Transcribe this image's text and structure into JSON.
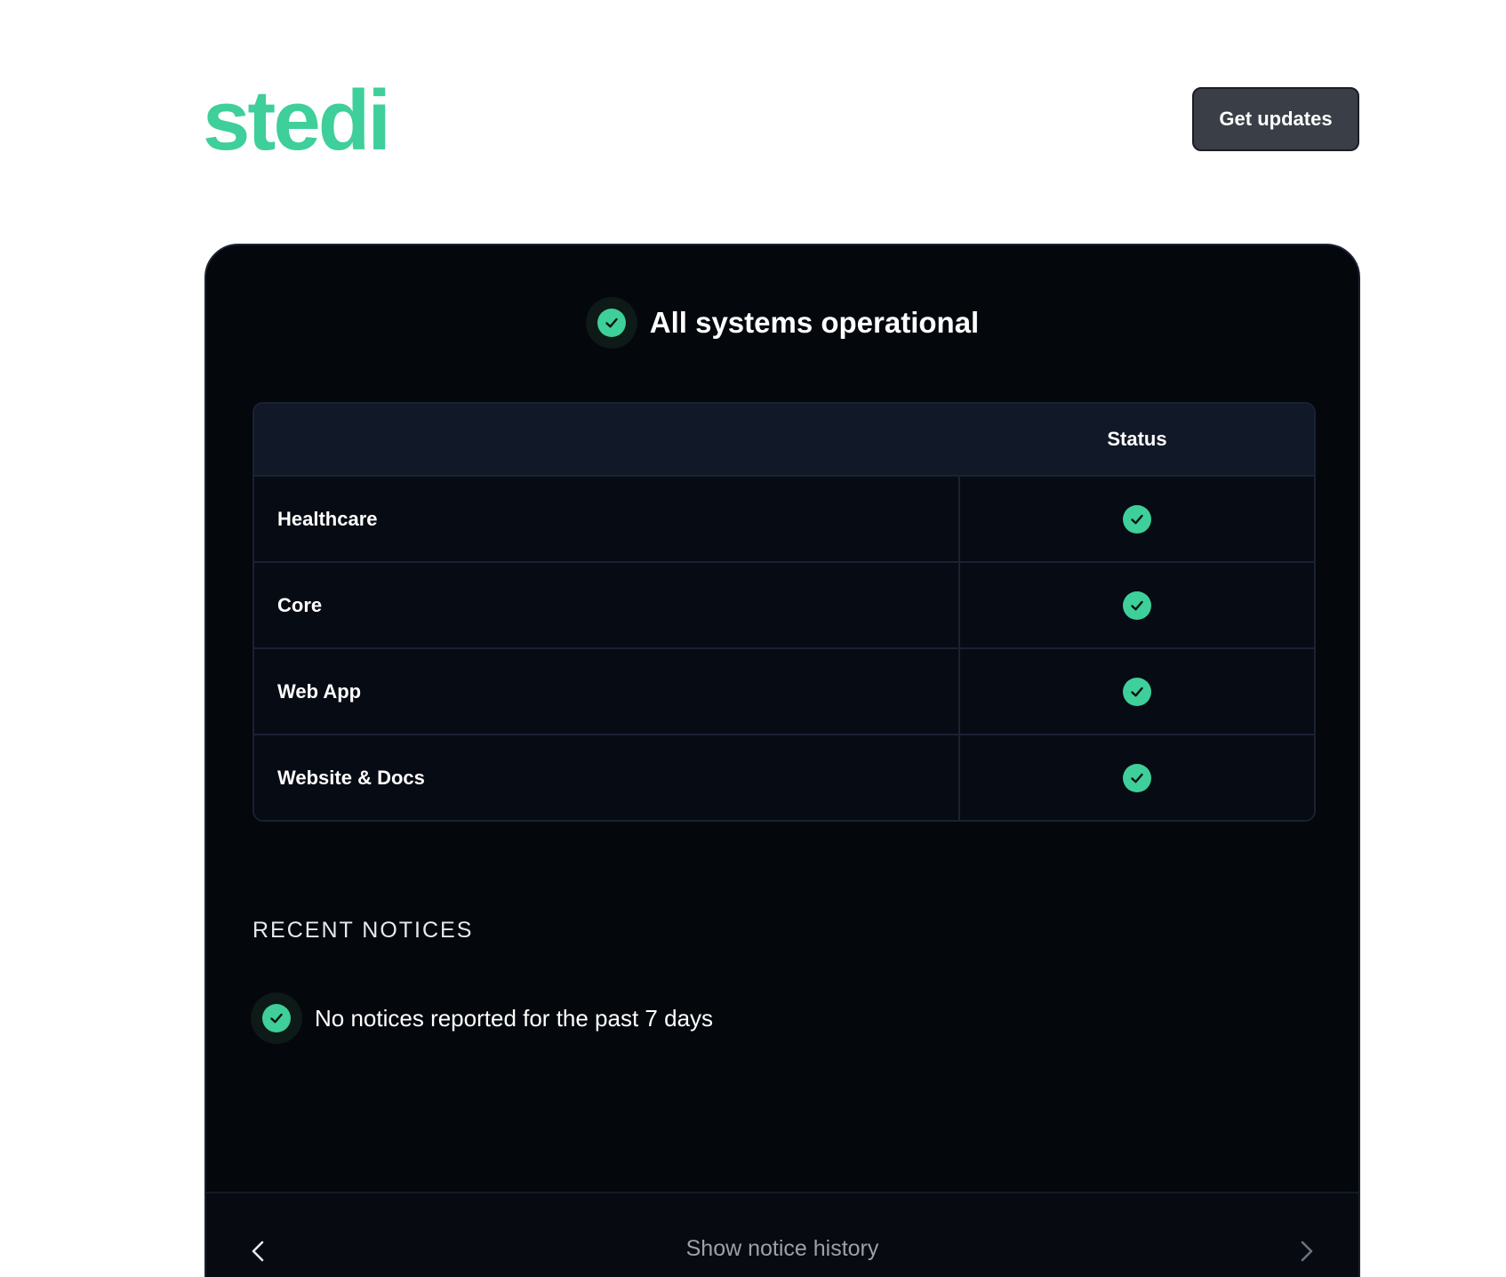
{
  "brand": {
    "logo_text": "stedi",
    "accent_color": "#3ecf9a"
  },
  "header": {
    "get_updates_label": "Get updates"
  },
  "overall_status": {
    "text": "All systems operational",
    "icon": "check-circle-icon"
  },
  "table": {
    "status_header": "Status",
    "components": [
      {
        "name": "Healthcare",
        "status": "operational"
      },
      {
        "name": "Core",
        "status": "operational"
      },
      {
        "name": "Web App",
        "status": "operational"
      },
      {
        "name": "Website & Docs",
        "status": "operational"
      }
    ]
  },
  "notices": {
    "title": "RECENT NOTICES",
    "empty_text": "No notices reported for the past 7 days"
  },
  "footer": {
    "history_label": "Show notice history",
    "prev_icon": "chevron-left-icon",
    "next_icon": "chevron-right-icon"
  }
}
